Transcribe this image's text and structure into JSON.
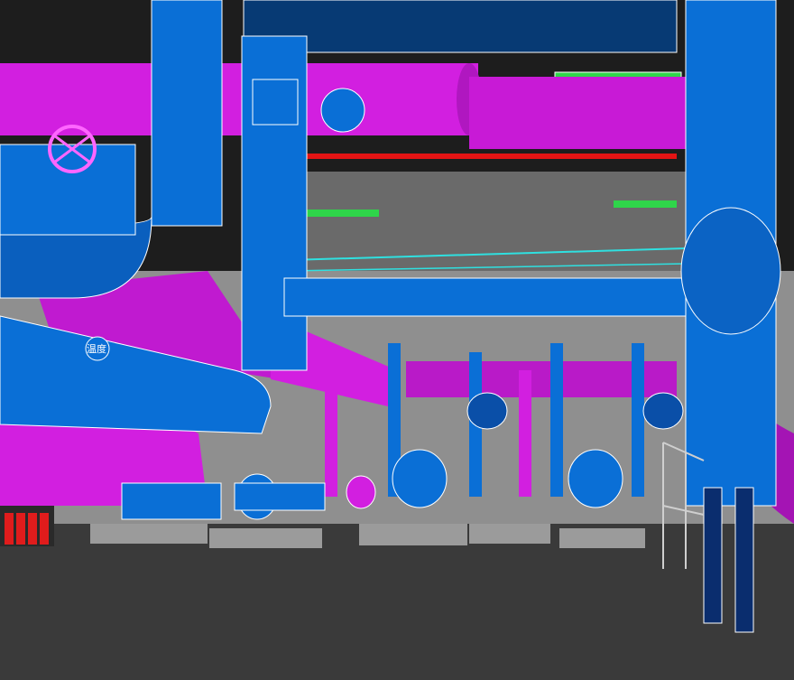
{
  "scene": {
    "description_label": "",
    "pipe_label": "温度",
    "colors": {
      "blue_pipe": "#0a6fd6",
      "blue_pipe_dark": "#043f82",
      "magenta_pipe": "#d21fe0",
      "magenta_dark": "#7a0f86",
      "floor": "#3a3a3a",
      "ceiling_dark": "#1c1c1c",
      "concrete": "#9b9b9b",
      "green_tray": "#2fd54a",
      "red_line": "#e31414",
      "cyan_line": "#2fe0e0",
      "fire_red": "#e01c1c"
    },
    "icons": [
      "valve-wheel-icon",
      "gauge-icon",
      "pump-icon",
      "fire-cylinder-icon"
    ]
  }
}
